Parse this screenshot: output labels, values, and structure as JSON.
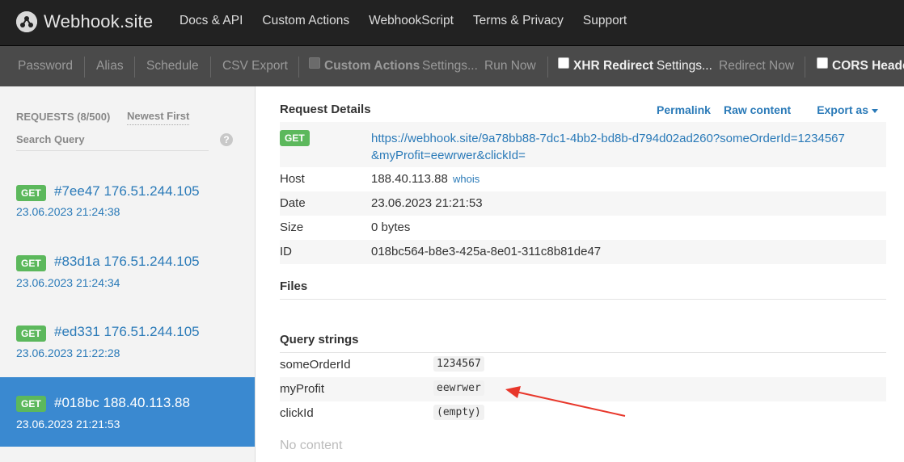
{
  "navbar": {
    "brand": "Webhook.site",
    "links": [
      "Docs & API",
      "Custom Actions",
      "WebhookScript",
      "Terms & Privacy",
      "Support"
    ]
  },
  "toolbar": {
    "password": "Password",
    "alias": "Alias",
    "schedule": "Schedule",
    "csv_export": "CSV Export",
    "custom_actions": "Custom Actions",
    "ca_settings": "Settings...",
    "run_now": "Run Now",
    "xhr_redirect": "XHR Redirect",
    "xhr_settings": "Settings...",
    "redirect_now": "Redirect Now",
    "cors_headers": "CORS Heade"
  },
  "sidebar": {
    "requests_label": "REQUESTS (8/500)",
    "sort_label": "Newest First",
    "search_label": "Search Query",
    "help": "?",
    "requests": [
      {
        "method": "GET",
        "title": "#7ee47 176.51.244.105",
        "date": "23.06.2023 21:24:38"
      },
      {
        "method": "GET",
        "title": "#83d1a 176.51.244.105",
        "date": "23.06.2023 21:24:34"
      },
      {
        "method": "GET",
        "title": "#ed331 176.51.244.105",
        "date": "23.06.2023 21:22:28"
      },
      {
        "method": "GET",
        "title": "#018bc 188.40.113.88",
        "date": "23.06.2023 21:21:53"
      }
    ]
  },
  "details": {
    "title": "Request Details",
    "permalink": "Permalink",
    "raw_content": "Raw content",
    "export_as": "Export as",
    "method": "GET",
    "url_line1": "https://webhook.site/9a78bb88-7dc1-4bb2-bd8b-d794d02ad260?someOrderId=1234567",
    "url_line2": "&myProfit=eewrwer&clickId=",
    "host_label": "Host",
    "host_value": "188.40.113.88",
    "whois": "whois",
    "date_label": "Date",
    "date_value": "23.06.2023 21:21:53",
    "size_label": "Size",
    "size_value": "0 bytes",
    "id_label": "ID",
    "id_value": "018bc564-b8e3-425a-8e01-311c8b81de47",
    "files_title": "Files",
    "query_title": "Query strings",
    "query": [
      {
        "key": "someOrderId",
        "value": "1234567"
      },
      {
        "key": "myProfit",
        "value": "eewrwer"
      },
      {
        "key": "clickId",
        "value": "(empty)"
      }
    ],
    "no_content": "No content"
  },
  "colors": {
    "navbar_bg": "#222222",
    "toolbar_bg": "#4a4a4a",
    "link": "#2a7ab8",
    "active_request": "#3a89d0",
    "get_badge": "#5cb85c",
    "annotation_arrow": "#e8372b"
  }
}
